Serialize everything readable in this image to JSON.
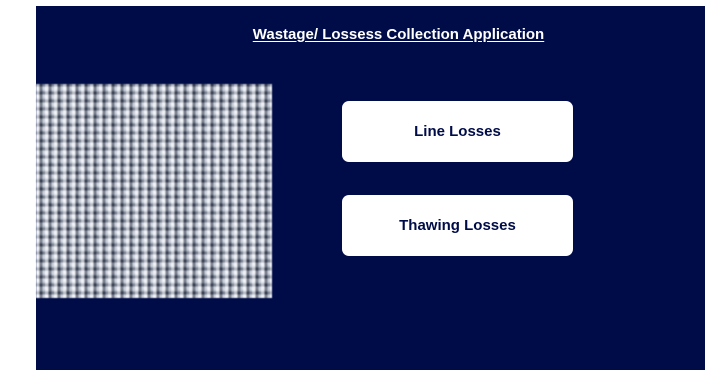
{
  "app": {
    "title": "Wastage/ Lossess Collection Application",
    "background_color": "#000c48"
  },
  "image": {
    "description_icon": "fabric-texture-image"
  },
  "buttons": {
    "line_losses_label": "Line Losses",
    "thawing_losses_label": "Thawing Losses",
    "background_color": "#ffffff",
    "text_color": "#000c48"
  }
}
